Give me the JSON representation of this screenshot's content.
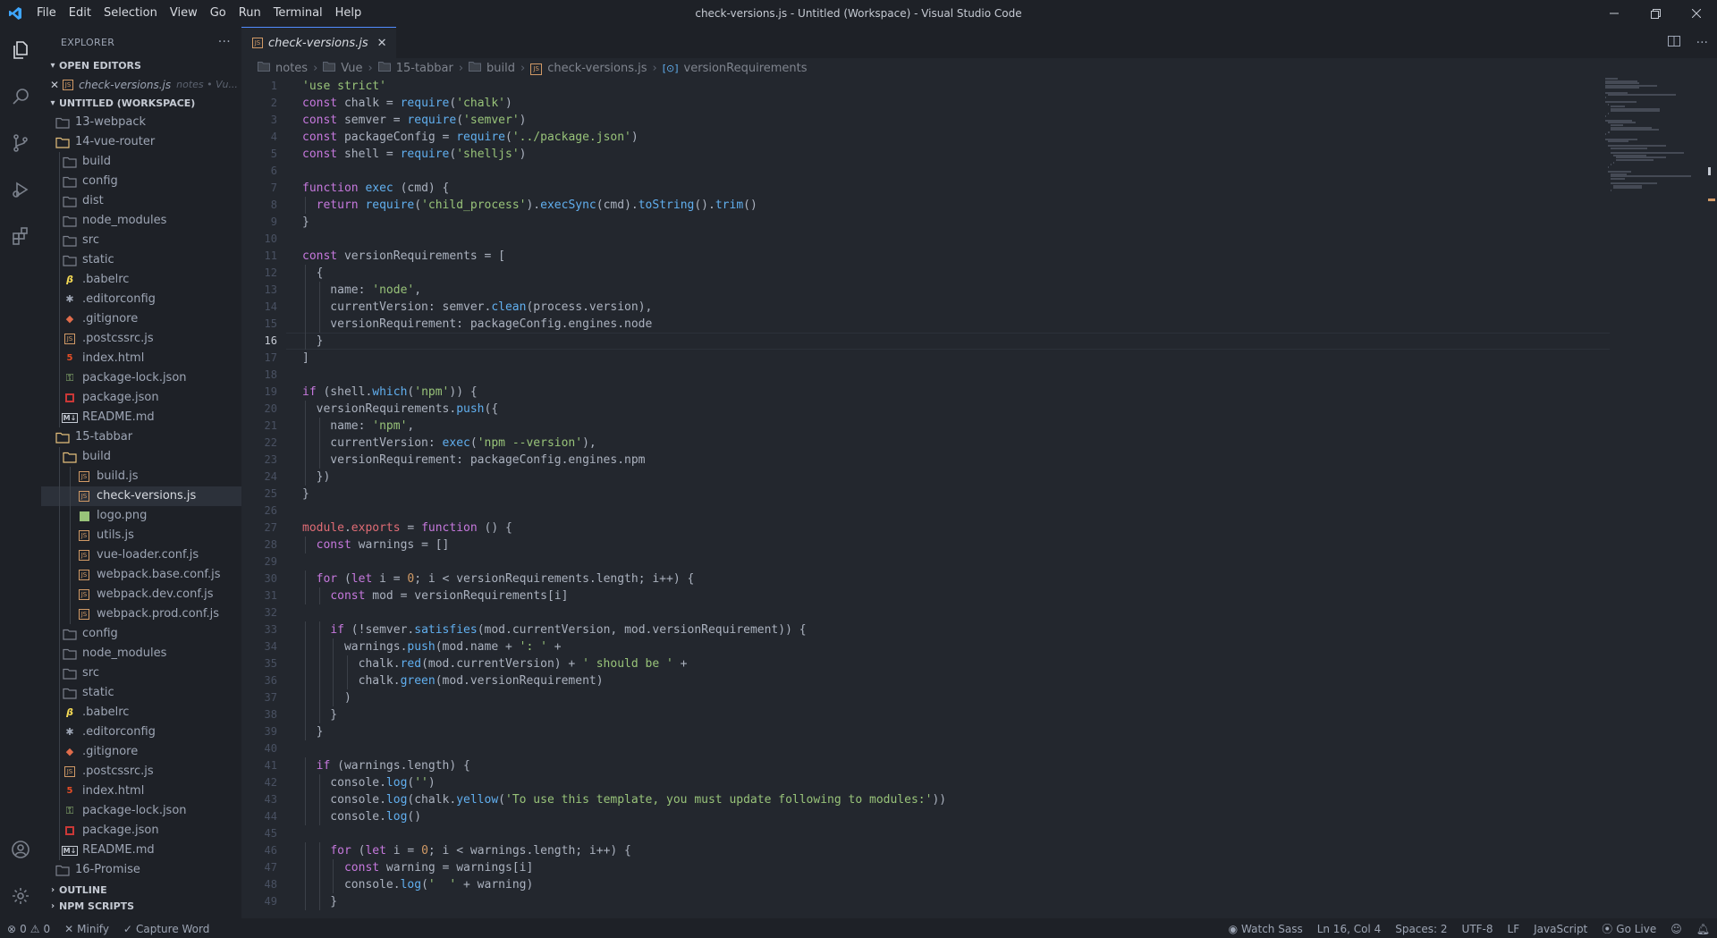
{
  "window": {
    "title": "check-versions.js - Untitled (Workspace) - Visual Studio Code",
    "menu": [
      "File",
      "Edit",
      "Selection",
      "View",
      "Go",
      "Run",
      "Terminal",
      "Help"
    ]
  },
  "sidebar": {
    "title": "EXPLORER",
    "open_editors_label": "OPEN EDITORS",
    "open_editor": {
      "name": "check-versions.js",
      "desc": "notes • Vu..."
    },
    "workspace_label": "UNTITLED (WORKSPACE)",
    "tree": [
      {
        "label": "13-webpack",
        "type": "folder",
        "depth": 1
      },
      {
        "label": "14-vue-router",
        "type": "folder-open",
        "depth": 1
      },
      {
        "label": "build",
        "type": "folder",
        "depth": 2
      },
      {
        "label": "config",
        "type": "folder",
        "depth": 2
      },
      {
        "label": "dist",
        "type": "folder",
        "depth": 2
      },
      {
        "label": "node_modules",
        "type": "folder",
        "depth": 2
      },
      {
        "label": "src",
        "type": "folder",
        "depth": 2
      },
      {
        "label": "static",
        "type": "folder",
        "depth": 2
      },
      {
        "label": ".babelrc",
        "type": "babel",
        "depth": 2
      },
      {
        "label": ".editorconfig",
        "type": "config",
        "depth": 2
      },
      {
        "label": ".gitignore",
        "type": "git",
        "depth": 2
      },
      {
        "label": ".postcssrc.js",
        "type": "js",
        "depth": 2
      },
      {
        "label": "index.html",
        "type": "html",
        "depth": 2
      },
      {
        "label": "package-lock.json",
        "type": "lock",
        "depth": 2
      },
      {
        "label": "package.json",
        "type": "npm",
        "depth": 2
      },
      {
        "label": "README.md",
        "type": "md",
        "depth": 2
      },
      {
        "label": "15-tabbar",
        "type": "folder-open",
        "depth": 1
      },
      {
        "label": "build",
        "type": "folder-open",
        "depth": 2
      },
      {
        "label": "build.js",
        "type": "js",
        "depth": 3
      },
      {
        "label": "check-versions.js",
        "type": "js",
        "depth": 3,
        "selected": true
      },
      {
        "label": "logo.png",
        "type": "img",
        "depth": 3
      },
      {
        "label": "utils.js",
        "type": "js",
        "depth": 3
      },
      {
        "label": "vue-loader.conf.js",
        "type": "js",
        "depth": 3
      },
      {
        "label": "webpack.base.conf.js",
        "type": "js",
        "depth": 3
      },
      {
        "label": "webpack.dev.conf.js",
        "type": "js",
        "depth": 3
      },
      {
        "label": "webpack.prod.conf.js",
        "type": "js",
        "depth": 3
      },
      {
        "label": "config",
        "type": "folder",
        "depth": 2
      },
      {
        "label": "node_modules",
        "type": "folder",
        "depth": 2
      },
      {
        "label": "src",
        "type": "folder",
        "depth": 2
      },
      {
        "label": "static",
        "type": "folder",
        "depth": 2
      },
      {
        "label": ".babelrc",
        "type": "babel",
        "depth": 2
      },
      {
        "label": ".editorconfig",
        "type": "config",
        "depth": 2
      },
      {
        "label": ".gitignore",
        "type": "git",
        "depth": 2
      },
      {
        "label": ".postcssrc.js",
        "type": "js",
        "depth": 2
      },
      {
        "label": "index.html",
        "type": "html",
        "depth": 2
      },
      {
        "label": "package-lock.json",
        "type": "lock",
        "depth": 2
      },
      {
        "label": "package.json",
        "type": "npm",
        "depth": 2
      },
      {
        "label": "README.md",
        "type": "md",
        "depth": 2
      },
      {
        "label": "16-Promise",
        "type": "folder",
        "depth": 1
      }
    ],
    "outline_label": "OUTLINE",
    "npm_scripts_label": "NPM SCRIPTS"
  },
  "editor": {
    "tab_label": "check-versions.js",
    "breadcrumb": [
      "notes",
      "Vue",
      "15-tabbar",
      "build",
      "check-versions.js",
      "versionRequirements"
    ],
    "active_line": 16,
    "lines": [
      "'use strict'",
      "const chalk = require('chalk')",
      "const semver = require('semver')",
      "const packageConfig = require('../package.json')",
      "const shell = require('shelljs')",
      "",
      "function exec (cmd) {",
      "  return require('child_process').execSync(cmd).toString().trim()",
      "}",
      "",
      "const versionRequirements = [",
      "  {",
      "    name: 'node',",
      "    currentVersion: semver.clean(process.version),",
      "    versionRequirement: packageConfig.engines.node",
      "  }",
      "]",
      "",
      "if (shell.which('npm')) {",
      "  versionRequirements.push({",
      "    name: 'npm',",
      "    currentVersion: exec('npm --version'),",
      "    versionRequirement: packageConfig.engines.npm",
      "  })",
      "}",
      "",
      "module.exports = function () {",
      "  const warnings = []",
      "",
      "  for (let i = 0; i < versionRequirements.length; i++) {",
      "    const mod = versionRequirements[i]",
      "",
      "    if (!semver.satisfies(mod.currentVersion, mod.versionRequirement)) {",
      "      warnings.push(mod.name + ': ' +",
      "        chalk.red(mod.currentVersion) + ' should be ' +",
      "        chalk.green(mod.versionRequirement)",
      "      )",
      "    }",
      "  }",
      "",
      "  if (warnings.length) {",
      "    console.log('')",
      "    console.log(chalk.yellow('To use this template, you must update following to modules:'))",
      "    console.log()",
      "",
      "    for (let i = 0; i < warnings.length; i++) {",
      "      const warning = warnings[i]",
      "      console.log('  ' + warning)",
      "    }"
    ]
  },
  "statusbar": {
    "errors": "0",
    "warnings": "0",
    "minify": "Minify",
    "capture_word": "Capture Word",
    "watch_sass": "Watch Sass",
    "position": "Ln 16, Col 4",
    "spaces": "Spaces: 2",
    "encoding": "UTF-8",
    "eol": "LF",
    "language": "JavaScript",
    "go_live": "Go Live"
  },
  "colors": {
    "accent": "#528bff",
    "keyword": "#c678dd",
    "string": "#98c379",
    "function": "#61afef",
    "number": "#d19a66",
    "background": "#23272e"
  }
}
